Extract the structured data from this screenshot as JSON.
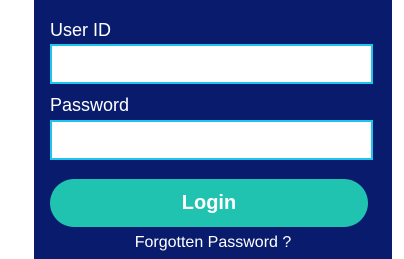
{
  "form": {
    "user_id": {
      "label": "User ID",
      "value": "",
      "placeholder": ""
    },
    "password": {
      "label": "Password",
      "value": "",
      "placeholder": ""
    },
    "login_label": "Login",
    "forgot_label": "Forgotten Password ?"
  },
  "colors": {
    "panel_bg": "#081b6c",
    "accent": "#1fc3b0",
    "field_border": "#1ec4ec"
  }
}
